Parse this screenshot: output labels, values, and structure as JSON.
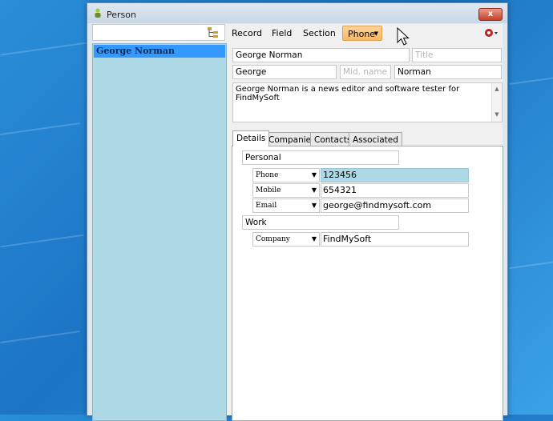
{
  "window": {
    "title": "Person",
    "close_glyph": "x"
  },
  "left": {
    "search": {
      "value": "",
      "placeholder": ""
    },
    "tree_icon": "tree-view-icon",
    "items": [
      {
        "label": "George Norman",
        "selected": true
      }
    ]
  },
  "toolbar": {
    "record": "Record",
    "field": "Field",
    "section": "Section",
    "phone": "Phone",
    "settings_icon": "settings-icon"
  },
  "form": {
    "full_name": "George Norman",
    "title_placeholder": "Title",
    "first_name": "George",
    "mid_name_placeholder": "Mid. name",
    "last_name": "Norman",
    "notes": "George Norman is a news editor and software tester for FindMySoft"
  },
  "tabs": [
    {
      "label": "Details",
      "active": true
    },
    {
      "label": "Companies",
      "active": false
    },
    {
      "label": "Contacts",
      "active": false
    },
    {
      "label": "Associated",
      "active": false
    }
  ],
  "details": {
    "personal_label": "Personal",
    "work_label": "Work",
    "personal_rows": [
      {
        "type": "Phone",
        "value": "123456"
      },
      {
        "type": "Mobile",
        "value": "654321"
      },
      {
        "type": "Email",
        "value": "george@findmysoft.com"
      }
    ],
    "work_rows": [
      {
        "type": "Company",
        "value": "FindMySoft"
      }
    ]
  },
  "colors": {
    "list_bg": "#add8e6",
    "selection": "#3399ff",
    "phone_button": "#f9b768",
    "desktop": "#1c74c4"
  }
}
